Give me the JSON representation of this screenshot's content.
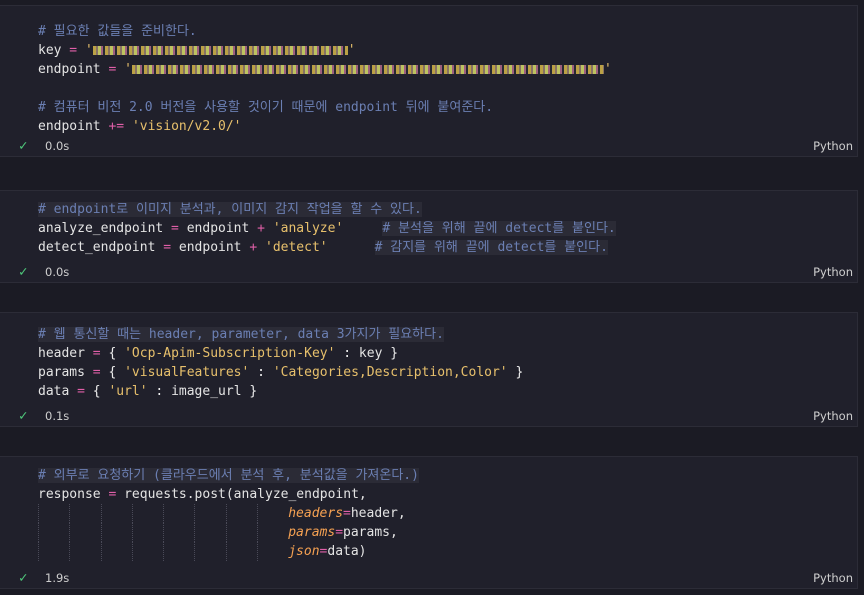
{
  "cells": [
    {
      "lines": [
        [
          {
            "t": "# 필요한 값들을 준비한다.",
            "c": "c"
          }
        ],
        [
          {
            "t": "key",
            "c": "v"
          },
          {
            "t": " = ",
            "c": "o"
          },
          {
            "t": "'",
            "c": "s"
          },
          {
            "redact": 255
          },
          {
            "t": "'",
            "c": "s"
          }
        ],
        [
          {
            "t": "endpoint",
            "c": "v"
          },
          {
            "t": " = ",
            "c": "o"
          },
          {
            "t": "'",
            "c": "s"
          },
          {
            "redact": 472
          },
          {
            "t": "'",
            "c": "s"
          }
        ],
        [],
        [
          {
            "t": "# 컴퓨터 비전 2.0 버전을 사용할 것이기 때문에 endpoint 뒤에 붙여준다.",
            "c": "c"
          }
        ],
        [
          {
            "t": "endpoint",
            "c": "v"
          },
          {
            "t": " += ",
            "c": "o"
          },
          {
            "t": "'vision/v2.0/'",
            "c": "s"
          }
        ]
      ],
      "time": "0.0s",
      "lang": "Python"
    },
    {
      "lines": [
        [
          {
            "t": "# endpoint로 이미지 분석과, 이미지 감지 작업을 할 수 있다.",
            "c": "c",
            "hl": true
          }
        ],
        [
          {
            "t": "analyze_endpoint",
            "c": "v"
          },
          {
            "t": " = ",
            "c": "o"
          },
          {
            "t": "endpoint",
            "c": "v"
          },
          {
            "t": " + ",
            "c": "o"
          },
          {
            "t": "'analyze'",
            "c": "s"
          },
          {
            "t": "     ",
            "c": "p"
          },
          {
            "t": "# 분석을 위해 끝에 detect를 붙인다.",
            "c": "c",
            "hl": true
          }
        ],
        [
          {
            "t": "detect_endpoint",
            "c": "v"
          },
          {
            "t": " = ",
            "c": "o"
          },
          {
            "t": "endpoint",
            "c": "v"
          },
          {
            "t": " + ",
            "c": "o"
          },
          {
            "t": "'detect'",
            "c": "s"
          },
          {
            "t": "      ",
            "c": "p"
          },
          {
            "t": "# 감지를 위해 끝에 detect를 붙인다.",
            "c": "c",
            "hl": true
          }
        ]
      ],
      "time": "0.0s",
      "lang": "Python"
    },
    {
      "lines": [
        [
          {
            "t": "# 웹 통신할 때는 header, parameter, data 3가지가 필요하다.",
            "c": "c",
            "hl": true
          }
        ],
        [
          {
            "t": "header",
            "c": "v"
          },
          {
            "t": " = ",
            "c": "o"
          },
          {
            "t": "{ ",
            "c": "p"
          },
          {
            "t": "'Ocp-Apim-Subscription-Key'",
            "c": "s"
          },
          {
            "t": " : ",
            "c": "p"
          },
          {
            "t": "key",
            "c": "v"
          },
          {
            "t": " }",
            "c": "p"
          }
        ],
        [
          {
            "t": "params",
            "c": "v"
          },
          {
            "t": " = ",
            "c": "o"
          },
          {
            "t": "{ ",
            "c": "p"
          },
          {
            "t": "'visualFeatures'",
            "c": "s"
          },
          {
            "t": " : ",
            "c": "p"
          },
          {
            "t": "'Categories,Description,Color'",
            "c": "s"
          },
          {
            "t": " }",
            "c": "p"
          }
        ],
        [
          {
            "t": "data",
            "c": "v"
          },
          {
            "t": " = ",
            "c": "o"
          },
          {
            "t": "{ ",
            "c": "p"
          },
          {
            "t": "'url'",
            "c": "s"
          },
          {
            "t": " : ",
            "c": "p"
          },
          {
            "t": "image_url",
            "c": "v"
          },
          {
            "t": " }",
            "c": "p"
          }
        ]
      ],
      "time": "0.1s",
      "lang": "Python"
    },
    {
      "lines": [
        [
          {
            "t": "# 외부로 요청하기 (클라우드에서 분석 후, 분석값을 가져온다.)",
            "c": "c",
            "hl": true
          }
        ],
        [
          {
            "t": "response",
            "c": "v"
          },
          {
            "t": " = ",
            "c": "o"
          },
          {
            "t": "requests.post(analyze_endpoint,",
            "c": "v"
          }
        ],
        [
          {
            "indent": 32
          },
          {
            "t": "headers",
            "c": "k"
          },
          {
            "t": "=",
            "c": "o"
          },
          {
            "t": "header,",
            "c": "v"
          }
        ],
        [
          {
            "indent": 32
          },
          {
            "t": "params",
            "c": "k"
          },
          {
            "t": "=",
            "c": "o"
          },
          {
            "t": "params,",
            "c": "v"
          }
        ],
        [
          {
            "indent": 32
          },
          {
            "t": "json",
            "c": "k"
          },
          {
            "t": "=",
            "c": "o"
          },
          {
            "t": "data)",
            "c": "v"
          }
        ]
      ],
      "time": "1.9s",
      "lang": "Python"
    }
  ]
}
